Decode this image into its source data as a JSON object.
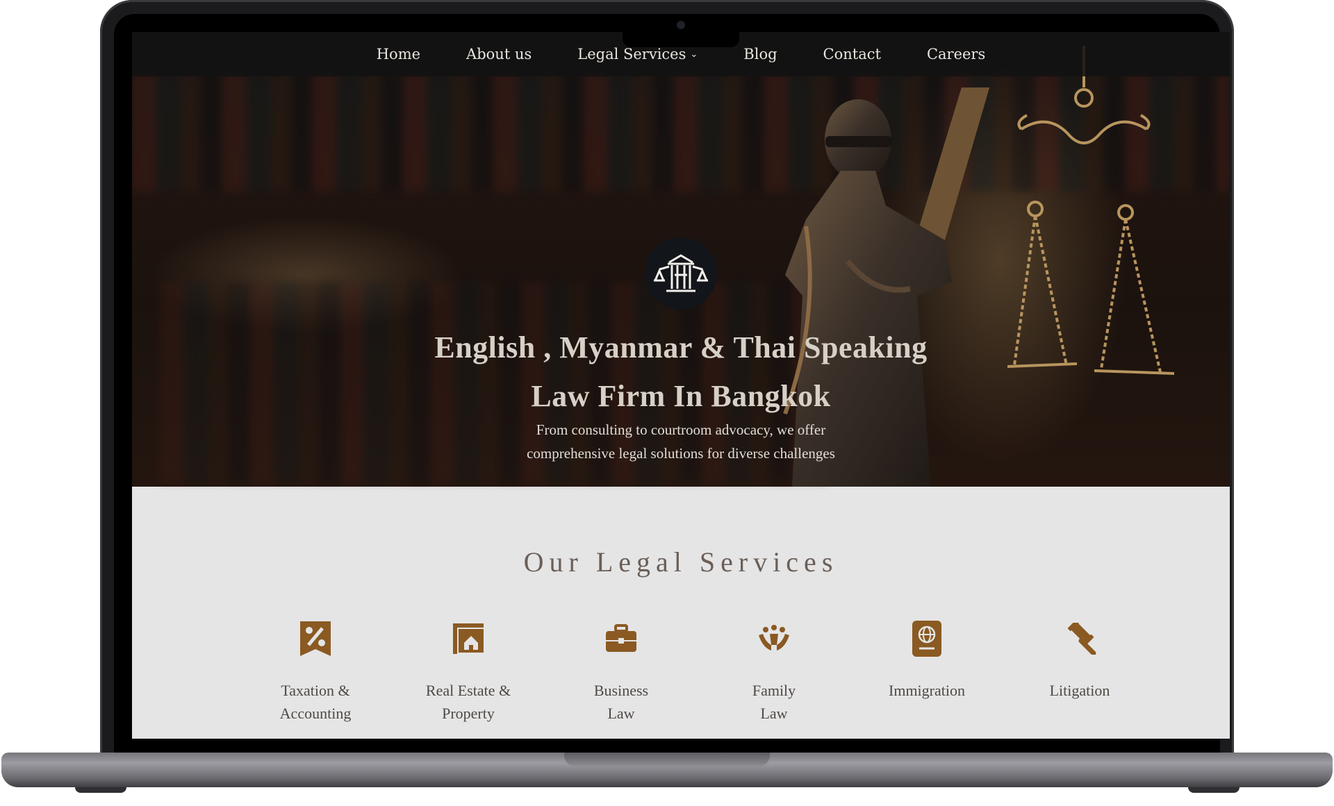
{
  "nav": {
    "items": [
      {
        "label": "Home"
      },
      {
        "label": "About us"
      },
      {
        "label": "Legal Services"
      },
      {
        "label": "Blog"
      },
      {
        "label": "Contact"
      },
      {
        "label": "Careers"
      }
    ]
  },
  "hero": {
    "title_line1": "English , Myanmar & Thai Speaking",
    "title_line2": "Law Firm In Bangkok",
    "subtitle_line1": "From consulting to courtroom advocacy, we offer",
    "subtitle_line2": "comprehensive legal solutions for diverse challenges"
  },
  "services": {
    "heading": "Our Legal Services",
    "items": [
      {
        "line1": "Taxation &",
        "line2": "Accounting",
        "icon": "tax-percent-icon"
      },
      {
        "line1": "Real Estate &",
        "line2": "Property",
        "icon": "house-frame-icon"
      },
      {
        "line1": "Business",
        "line2": "Law",
        "icon": "briefcase-icon"
      },
      {
        "line1": "Family",
        "line2": "Law",
        "icon": "family-hands-icon"
      },
      {
        "line1": "Immigration",
        "line2": "",
        "icon": "passport-icon"
      },
      {
        "line1": "Litigation",
        "line2": "",
        "icon": "gavel-icon"
      }
    ]
  },
  "colors": {
    "accent": "#8a5a22",
    "nav_bg": "#121212",
    "services_bg": "#e5e5e6",
    "heading_text": "#6b5f57"
  }
}
